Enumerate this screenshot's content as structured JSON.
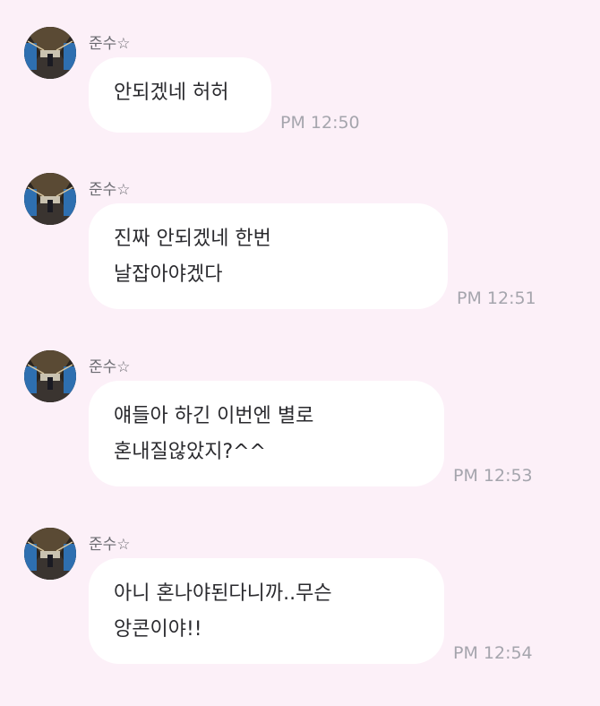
{
  "chat": {
    "background_color": "#fcf0f8",
    "messages": [
      {
        "sender": "준수☆",
        "text": "안되겠네 허허",
        "time": "PM 12:50"
      },
      {
        "sender": "준수☆",
        "text": "진짜 안되겠네 한번\n날잡아야겠다",
        "time": "PM 12:51"
      },
      {
        "sender": "준수☆",
        "text": "얘들아 하긴 이번엔 별로\n혼내질않았지?^^",
        "time": "PM 12:53"
      },
      {
        "sender": "준수☆",
        "text": "아니 혼나야된다니까..무슨\n앙콘이야!!",
        "time": "PM 12:54"
      }
    ]
  }
}
